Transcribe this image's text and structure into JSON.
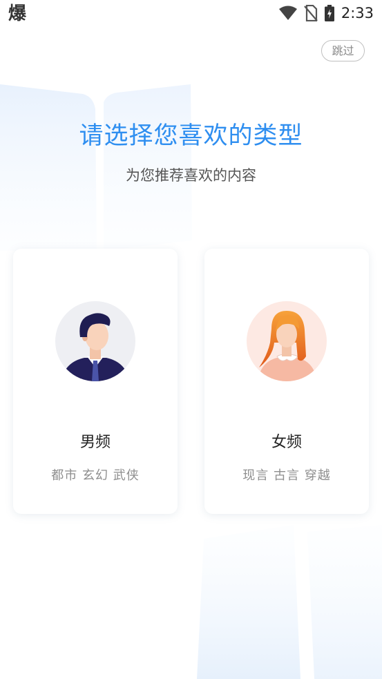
{
  "status_bar": {
    "app_icon_glyph": "爆",
    "time": "2:33",
    "icons": [
      "wifi-icon",
      "no-sim-icon",
      "battery-charging-icon"
    ]
  },
  "skip_label": "跳过",
  "title": "请选择您喜欢的类型",
  "subtitle": "为您推荐喜欢的内容",
  "options": [
    {
      "label": "男频",
      "tags": "都市 玄幻 武侠",
      "icon": "male-avatar-icon"
    },
    {
      "label": "女频",
      "tags": "现言 古言 穿越",
      "icon": "female-avatar-icon"
    }
  ],
  "colors": {
    "accent": "#2e8ef0",
    "male_bg": "#eeeff3",
    "female_bg": "#fde9e3"
  }
}
